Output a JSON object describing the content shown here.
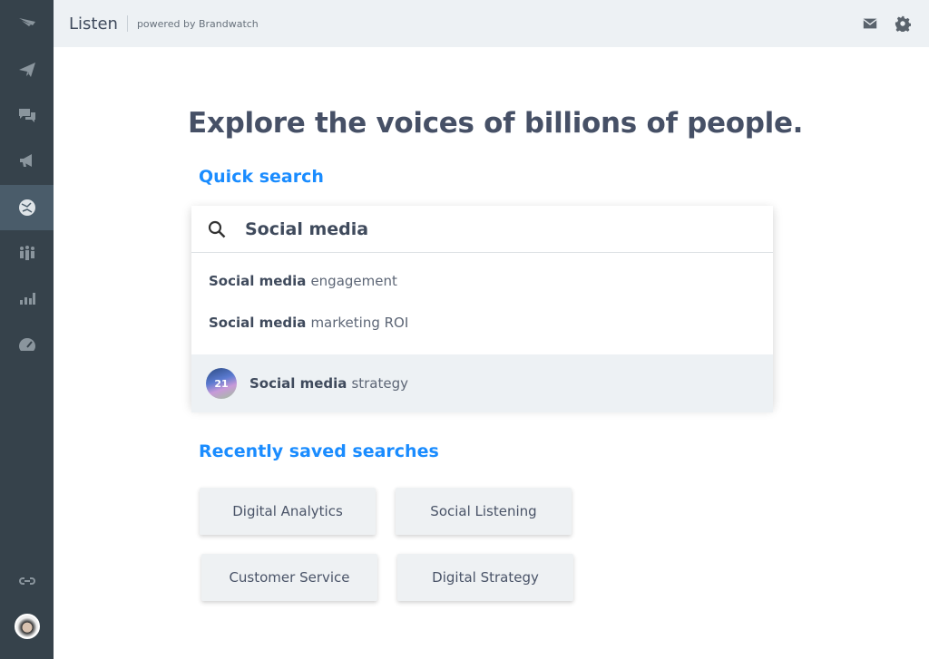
{
  "sidebar": {
    "items": [
      {
        "icon": "brand-logo-icon"
      },
      {
        "icon": "paper-plane-icon"
      },
      {
        "icon": "chat-bubbles-icon"
      },
      {
        "icon": "megaphone-icon"
      },
      {
        "icon": "globe-icon",
        "active": true
      },
      {
        "icon": "people-icon"
      },
      {
        "icon": "bar-chart-icon"
      },
      {
        "icon": "speedometer-icon"
      }
    ],
    "bottom": [
      {
        "icon": "link-icon"
      },
      {
        "icon": "user-avatar"
      }
    ]
  },
  "header": {
    "title": "Listen",
    "subtitle": "powered by Brandwatch"
  },
  "main": {
    "heading": "Explore the voices of billions of people.",
    "quick_search_label": "Quick search",
    "search_value": "Social media",
    "suggestions": [
      {
        "bold": "Social media",
        "rest": "engagement"
      },
      {
        "bold": "Social media",
        "rest": "marketing ROI"
      },
      {
        "bold": "Social media",
        "rest": "strategy",
        "thumb_text": "21"
      }
    ],
    "recent_label": "Recently saved searches",
    "recent": [
      "Digital Analytics",
      "Social Listening",
      "Customer Service",
      "Digital Strategy"
    ]
  },
  "colors": {
    "accent": "#1a8cff",
    "sidebar": "#36424b",
    "sidebar_active": "#4a5c6a"
  }
}
